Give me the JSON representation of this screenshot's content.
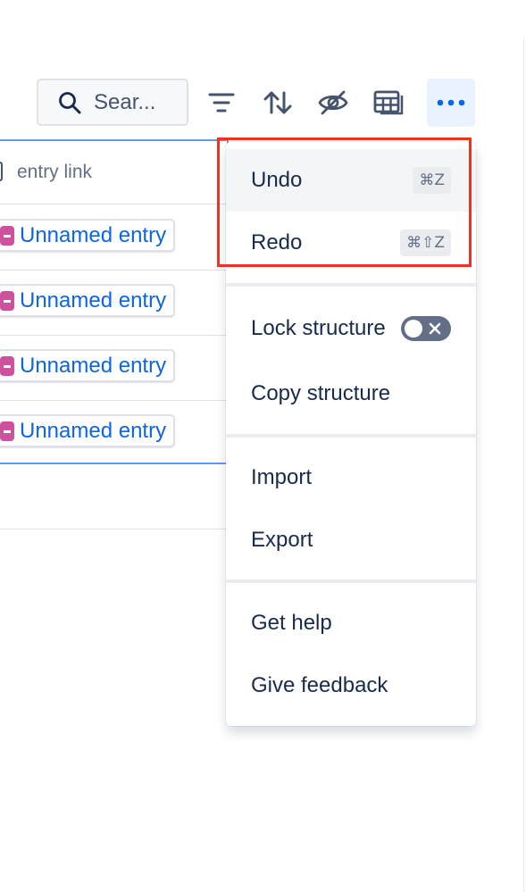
{
  "toolbar": {
    "search_placeholder": "Sear...",
    "icons": [
      "search-icon",
      "filter-icon",
      "sort-icon",
      "hide-fields-icon",
      "table-view-icon",
      "more-icon"
    ],
    "active_tool": "more"
  },
  "table": {
    "column_header": "entry link",
    "rows": [
      {
        "label": "Unnamed entry"
      },
      {
        "label": "Unnamed entry"
      },
      {
        "label": "Unnamed entry"
      },
      {
        "label": "Unnamed entry"
      }
    ]
  },
  "menu": {
    "undo": {
      "label": "Undo",
      "shortcut": "⌘Z"
    },
    "redo": {
      "label": "Redo",
      "shortcut": "⌘⇧Z"
    },
    "lock_structure": {
      "label": "Lock structure",
      "enabled": false
    },
    "copy_structure": {
      "label": "Copy structure"
    },
    "import": {
      "label": "Import"
    },
    "export": {
      "label": "Export"
    },
    "get_help": {
      "label": "Get help"
    },
    "give_feedback": {
      "label": "Give feedback"
    }
  },
  "colors": {
    "accent": "#0c66e4",
    "entry_icon": "#cd519d",
    "highlight_box": "#ea3323",
    "selection_border": "#579dff"
  }
}
